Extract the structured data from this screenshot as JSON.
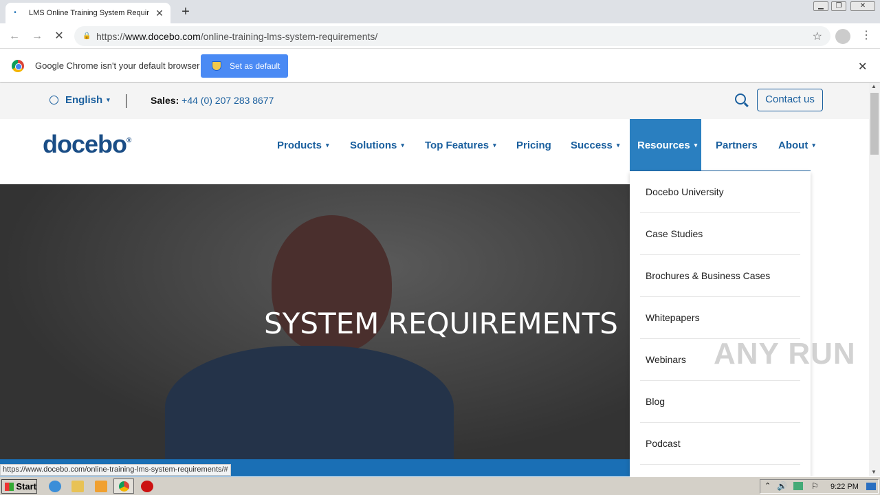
{
  "browser": {
    "tab_title": "LMS Online Training System Requirem",
    "tab_close": "✕",
    "new_tab": "+",
    "url_prefix": "https://",
    "url_host": "www.docebo.com",
    "url_path": "/online-training-lms-system-requirements/",
    "infobar_text": "Google Chrome isn't your default browser",
    "set_default_label": "Set as default",
    "infobar_close": "✕"
  },
  "topbar": {
    "language": "English",
    "sales_label": "Sales:",
    "sales_phone": "+44 (0) 207 283 8677",
    "contact_label": "Contact us"
  },
  "logo": {
    "text": "docebo",
    "mark": "®"
  },
  "nav": {
    "items": [
      {
        "label": "Products",
        "caret": "▾"
      },
      {
        "label": "Solutions",
        "caret": "▾"
      },
      {
        "label": "Top Features",
        "caret": "▾"
      },
      {
        "label": "Pricing",
        "caret": ""
      },
      {
        "label": "Success",
        "caret": "▾"
      },
      {
        "label": "Resources",
        "caret": "▾"
      },
      {
        "label": "Partners",
        "caret": ""
      },
      {
        "label": "About",
        "caret": "▾"
      }
    ]
  },
  "hero": {
    "title": "SYSTEM REQUIREMENTS"
  },
  "resources_menu": {
    "items": [
      "Docebo University",
      "Case Studies",
      "Brochures & Business Cases",
      "Whitepapers",
      "Webinars",
      "Blog",
      "Podcast"
    ]
  },
  "status_url": "https://www.docebo.com/online-training-lms-system-requirements/#",
  "watermark": "ANY RUN",
  "taskbar": {
    "start_label": "Start",
    "clock": "9:22 PM"
  },
  "colors": {
    "brand_blue": "#1a5f9e",
    "active_nav": "#2a7fc0",
    "button_blue": "#4a8af4"
  }
}
